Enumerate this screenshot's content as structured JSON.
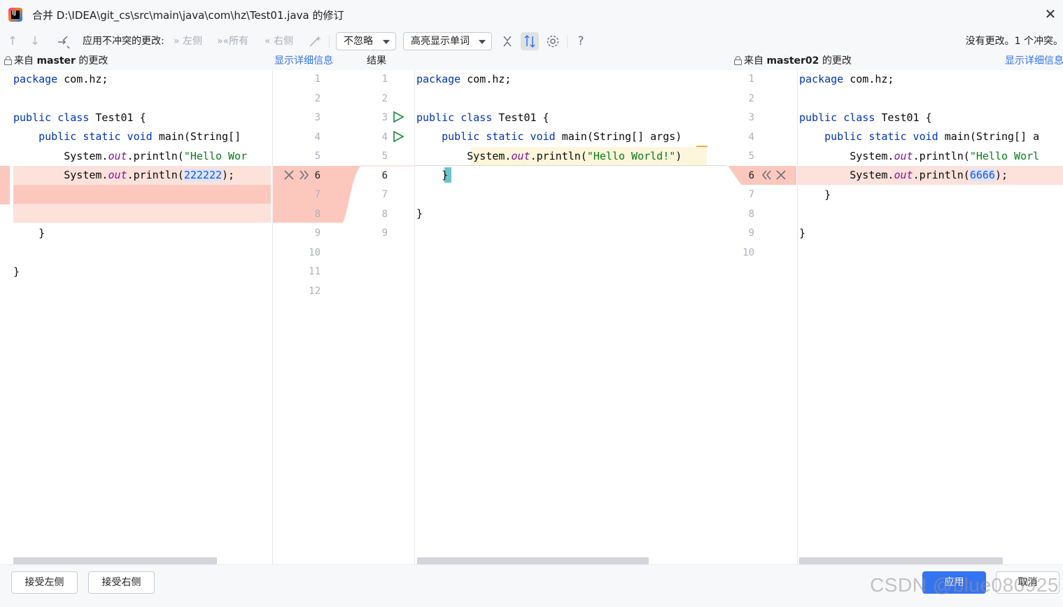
{
  "window": {
    "title": "合并 D:\\IDEA\\git_cs\\src\\main\\java\\com\\hz\\Test01.java 的修订",
    "close_glyph": "✕"
  },
  "toolbar": {
    "prev_icon": "↑",
    "next_icon": "↓",
    "apply_nonconflicting_label": "应用不冲突的更改:",
    "left_label": "左侧",
    "all_label": "所有",
    "right_label": "右侧",
    "ignore_dropdown": "不忽略",
    "highlight_dropdown": "高亮显示单词",
    "help_glyph": "?",
    "status": "没有更改。1 个冲突。"
  },
  "left_panel": {
    "header_prefix": "来自 ",
    "branch": "master",
    "header_suffix": " 的更改",
    "details_link": "显示详细信息"
  },
  "center_panel": {
    "header": "结果"
  },
  "right_panel": {
    "header_prefix": "来自 ",
    "branch": "master02",
    "header_suffix": " 的更改",
    "details_link": "显示详细信息"
  },
  "left_line_numbers": [
    "1",
    "2",
    "3",
    "4",
    "5",
    "6",
    "7",
    "8",
    "9",
    "10",
    "11",
    "12"
  ],
  "center_line_numbers": [
    "1",
    "2",
    "3",
    "4",
    "5",
    "6",
    "7",
    "8",
    "9"
  ],
  "right_line_numbers": [
    "1",
    "2",
    "3",
    "4",
    "5",
    "6",
    "7",
    "8",
    "9",
    "10"
  ],
  "code": {
    "package_kw": "package",
    "package_name": " com.hz;",
    "public_kw": "public",
    "class_kw": " class",
    "class_rest": " Test01 {",
    "static_kw": " static",
    "void_kw": " void",
    "main_left": " main(String[]",
    "main_center": " main(String[] args)",
    "main_right": " main(String[] a",
    "system": "System.",
    "out": "out",
    "println_open": ".println(",
    "hello_left": "\"Hello Wor",
    "hello_center": "\"Hello World!\"",
    "hello_right": "\"Hello Worl",
    "close_paren": ")",
    "left_value": "222222",
    "right_value": "6666",
    "stmt_end": ");",
    "brace_close": "}",
    "indent1": "    ",
    "indent2": "        "
  },
  "buttons": {
    "accept_left": "接受左侧",
    "accept_right": "接受右侧",
    "apply": "应用",
    "cancel": "取消"
  },
  "watermark": "CSDN @blue080925",
  "colors": {
    "conflict": "#fcc8bd",
    "conflict_light": "#fde2dc",
    "accent": "#3574f0",
    "keyword": "#0033b3",
    "string": "#067d17",
    "field": "#871094",
    "number": "#1750eb",
    "run_green": "#208a3c"
  }
}
